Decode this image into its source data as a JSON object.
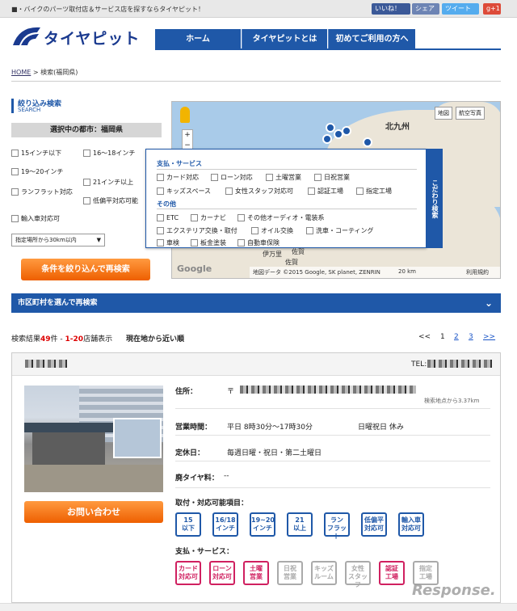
{
  "topbar": {
    "tagline": "■・バイクのパーツ取付店＆サービス店を探すならタイヤピット！",
    "fb_like": "いいね！",
    "share": "シェア",
    "tweet": "ツイート",
    "gplus": "g+1"
  },
  "logo": {
    "text": "タイヤピット"
  },
  "nav": {
    "items": [
      "ホーム",
      "タイヤピットとは",
      "初めてご利用の方へ"
    ]
  },
  "breadcrumb": {
    "home": "HOME",
    "sep": ">",
    "current": "検索(福岡県)"
  },
  "sidebar": {
    "heading": "絞り込み検索",
    "heading_en": "SEARCH",
    "city": "選択中の都市：福岡県",
    "options": [
      "15インチ以下",
      "16〜18インチ",
      "19〜20インチ",
      "21インチ以上",
      "ランフラット対応",
      "低偏平対応可能",
      "輸入車対応可"
    ],
    "distance_select": "指定場所から30km以内",
    "search_button": "条件を絞り込んで再検索"
  },
  "map": {
    "btn_map": "地図",
    "btn_sat": "航空写真",
    "label_city": "北九州",
    "label_a": "飯塚",
    "label_b": "佐賀",
    "label_c": "伊万里",
    "footer": "地図データ ©2015 Google, SK planet, ZENRIN",
    "scale": "20 km",
    "terms": "利用規約",
    "google": "Google"
  },
  "filter": {
    "tab": "こだわり検索",
    "sec1": "支払・サービス",
    "sec1_items": [
      "カード対応",
      "ローン対応",
      "土曜営業",
      "日祝営業",
      "キッズスペース",
      "女性スタッフ対応可",
      "認証工場",
      "指定工場"
    ],
    "sec2": "その他",
    "sec2_items": [
      "ETC",
      "カーナビ",
      "その他オーディオ・電装系",
      "エクステリア交換・取付",
      "オイル交換",
      "洗車・コーティング",
      "車検",
      "板金塗装",
      "自動車保険"
    ]
  },
  "areabar": {
    "label": "市区町村を選んで再検索",
    "chevron": "⌄"
  },
  "results": {
    "prefix": "検索結果",
    "count": "49",
    "unit": "件",
    "dash": " - ",
    "range": "1-20",
    "suffix": "店舗表示",
    "sort": "現在地から近い順"
  },
  "pager": {
    "prev": "<<",
    "p1": "1",
    "p2": "2",
    "p3": "3",
    "next": ">>"
  },
  "shop": {
    "tel_label": "TEL:",
    "addr_label": "住所：",
    "addr_prefix": "〒",
    "distance": "検索地点から3.37km",
    "hours_label": "営業時間：",
    "hours": "平日 8時30分〜17時30分",
    "holiday_note": "日曜祝日 休み",
    "closed_label": "定休日：",
    "closed": "毎週日曜・祝日・第二土曜日",
    "waste_label": "廃タイヤ料：",
    "waste": "--",
    "items_label": "取付・対応可能項目：",
    "contact_button": "お問い合わせ",
    "service_label": "支払・サービス："
  },
  "icons_fit": [
    {
      "top": "15",
      "bottom": "以下"
    },
    {
      "top": "16/18",
      "bottom": "インチ"
    },
    {
      "top": "19~20",
      "bottom": "インチ"
    },
    {
      "top": "21",
      "bottom": "以上"
    },
    {
      "top": "ラン",
      "bottom": "フラット"
    },
    {
      "top": "低偏平",
      "bottom": "対応可"
    },
    {
      "top": "輸入車",
      "bottom": "対応可"
    }
  ],
  "icons_service": [
    {
      "top": "カード",
      "bottom": "対応可"
    },
    {
      "top": "ローン",
      "bottom": "対応可"
    },
    {
      "top": "土曜",
      "bottom": "営業"
    },
    {
      "top": "日祝",
      "bottom": "営業"
    },
    {
      "top": "キッズ",
      "bottom": "ルーム"
    },
    {
      "top": "女性",
      "bottom": "スタッフ"
    },
    {
      "top": "認証",
      "bottom": "工場"
    },
    {
      "top": "指定",
      "bottom": "工場"
    }
  ],
  "watermark": "Response."
}
